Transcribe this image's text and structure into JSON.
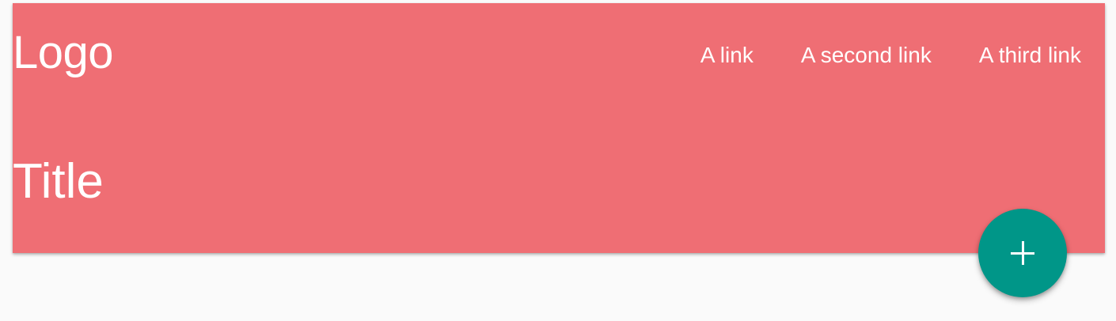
{
  "colors": {
    "header_background": "#ef6e74",
    "fab_background": "#009688",
    "text": "#ffffff",
    "page_background": "#fafafa"
  },
  "header": {
    "logo": "Logo",
    "nav": {
      "links": [
        "A link",
        "A second link",
        "A third link"
      ]
    },
    "title": "Title"
  },
  "fab": {
    "icon": "plus-icon"
  }
}
